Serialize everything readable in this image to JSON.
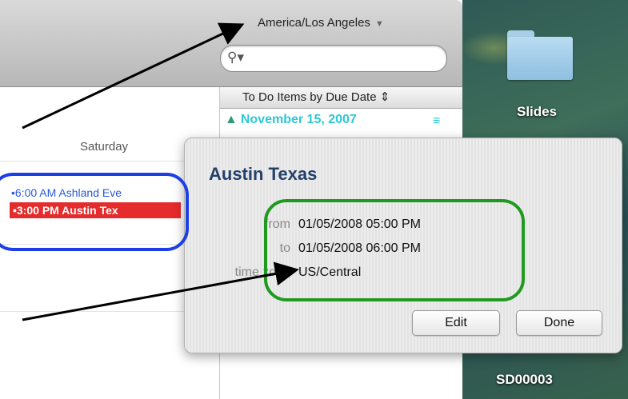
{
  "toolbar": {
    "timezone": "America/Los Angeles",
    "search_placeholder": ""
  },
  "calendar": {
    "day_label": "Saturday",
    "events": [
      {
        "time_title": "6:00 AM Ashland Eve",
        "color": "#2a58d8"
      },
      {
        "time_title": "3:00 PM Austin Tex",
        "color": "#e52b2b"
      }
    ]
  },
  "todo": {
    "header": "To Do Items by Due Date",
    "items": [
      {
        "date": "November 15, 2007"
      }
    ]
  },
  "desktop": {
    "icons": [
      {
        "label": "Slides",
        "icon": "folder-icon"
      },
      {
        "label": "SD00003",
        "icon": "folder-icon"
      }
    ]
  },
  "popover": {
    "title": "Austin Texas",
    "from_label": "from",
    "from_value": "01/05/2008 05:00 PM",
    "to_label": "to",
    "to_value": "01/05/2008 06:00 PM",
    "timezone_label": "time zone",
    "timezone_value": "US/Central",
    "edit_label": "Edit",
    "done_label": "Done"
  },
  "annotation_colors": {
    "blue": "#1b3ee6",
    "green": "#1f9a1f"
  }
}
